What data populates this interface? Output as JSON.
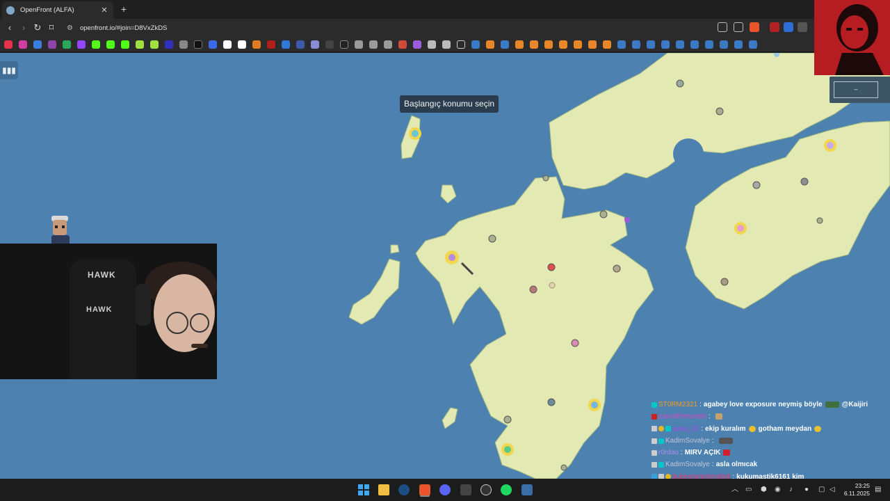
{
  "browser": {
    "tab_title": "OpenFront (ALFA)",
    "url": "openfront.io/#join=D8VxZkDS"
  },
  "map": {
    "tooltip": "Başlangıç konumu seçin",
    "water_color": "#4d81b0",
    "land_color": "#e2e9b3"
  },
  "overlay": {
    "chair_brand": "HAWK",
    "mini_panel_text": "–"
  },
  "chat": {
    "lines": [
      {
        "user": "ST0RM2321",
        "user_color": "#f59a23",
        "text": "agabey love exposure neymiş böyle",
        "mention": "@Kaijiri"
      },
      {
        "user": "zamattheturash",
        "user_color": "#d44cc8",
        "text": ""
      },
      {
        "user": "pasa_02",
        "user_color": "#a64ce8",
        "text": "ekip kuralım",
        "extra": "gotham meydan"
      },
      {
        "user": "KadimSovalye",
        "user_color": "#c4c4d4",
        "text": ""
      },
      {
        "user": "r0rdao",
        "user_color": "#b48cf0",
        "text": "MIRV AÇIK"
      },
      {
        "user": "KadimSovalye",
        "user_color": "#c4c4d4",
        "text": "asla olmıcak"
      },
      {
        "user": "bubenisimirlendirdi",
        "user_color": "#e8326e",
        "text": "kukumastik6161 kim"
      }
    ]
  },
  "taskbar": {
    "time": "23:25",
    "date": "6.11.2025"
  }
}
